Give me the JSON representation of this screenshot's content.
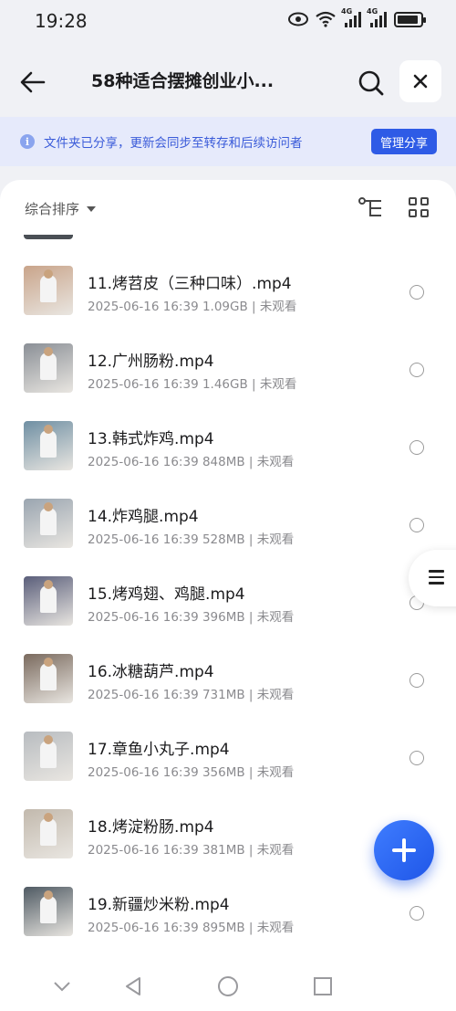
{
  "status_bar": {
    "time": "19:28",
    "network1": "4G",
    "network2": "4G",
    "battery_level": 0.9
  },
  "header": {
    "title": "58种适合摆摊创业小...",
    "back_icon": "back-arrow-icon",
    "search_icon": "search-icon",
    "close_icon": "close-icon"
  },
  "notice": {
    "text": "文件夹已分享，更新会同步至转存和后续访问者",
    "button_label": "管理分享",
    "icon": "info-icon"
  },
  "toolbar": {
    "sort_label": "综合排序",
    "tree_icon": "tree-view-icon",
    "grid_icon": "grid-view-icon"
  },
  "files": [
    {
      "name": "11.烤苕皮（三种口味）.mp4",
      "meta": "2025-06-16 16:39  1.09GB | 未观看",
      "thumb_color": "#c9a48a"
    },
    {
      "name": "12.广州肠粉.mp4",
      "meta": "2025-06-16 16:39  1.46GB | 未观看",
      "thumb_color": "#8a8f96"
    },
    {
      "name": "13.韩式炸鸡.mp4",
      "meta": "2025-06-16 16:39  848MB | 未观看",
      "thumb_color": "#6f8fa3"
    },
    {
      "name": "14.炸鸡腿.mp4",
      "meta": "2025-06-16 16:39  528MB | 未观看",
      "thumb_color": "#9aa5b0"
    },
    {
      "name": "15.烤鸡翅、鸡腿.mp4",
      "meta": "2025-06-16 16:39  396MB | 未观看",
      "thumb_color": "#5a5e7a"
    },
    {
      "name": "16.冰糖葫芦.mp4",
      "meta": "2025-06-16 16:39  731MB | 未观看",
      "thumb_color": "#7a6a5e"
    },
    {
      "name": "17.章鱼小丸子.mp4",
      "meta": "2025-06-16 16:39  356MB | 未观看",
      "thumb_color": "#b8bcc0"
    },
    {
      "name": "18.烤淀粉肠.mp4",
      "meta": "2025-06-16 16:39  381MB | 未观看",
      "thumb_color": "#c2b9ad"
    },
    {
      "name": "19.新疆炒米粉.mp4",
      "meta": "2025-06-16 16:39  895MB | 未观看",
      "thumb_color": "#4f5a63"
    }
  ],
  "floating": {
    "side_menu_icon": "menu-icon",
    "fab_icon": "plus-icon"
  },
  "navbar": {
    "items": [
      "chevron-down-icon",
      "back-triangle-icon",
      "home-circle-icon",
      "recents-square-icon"
    ]
  }
}
